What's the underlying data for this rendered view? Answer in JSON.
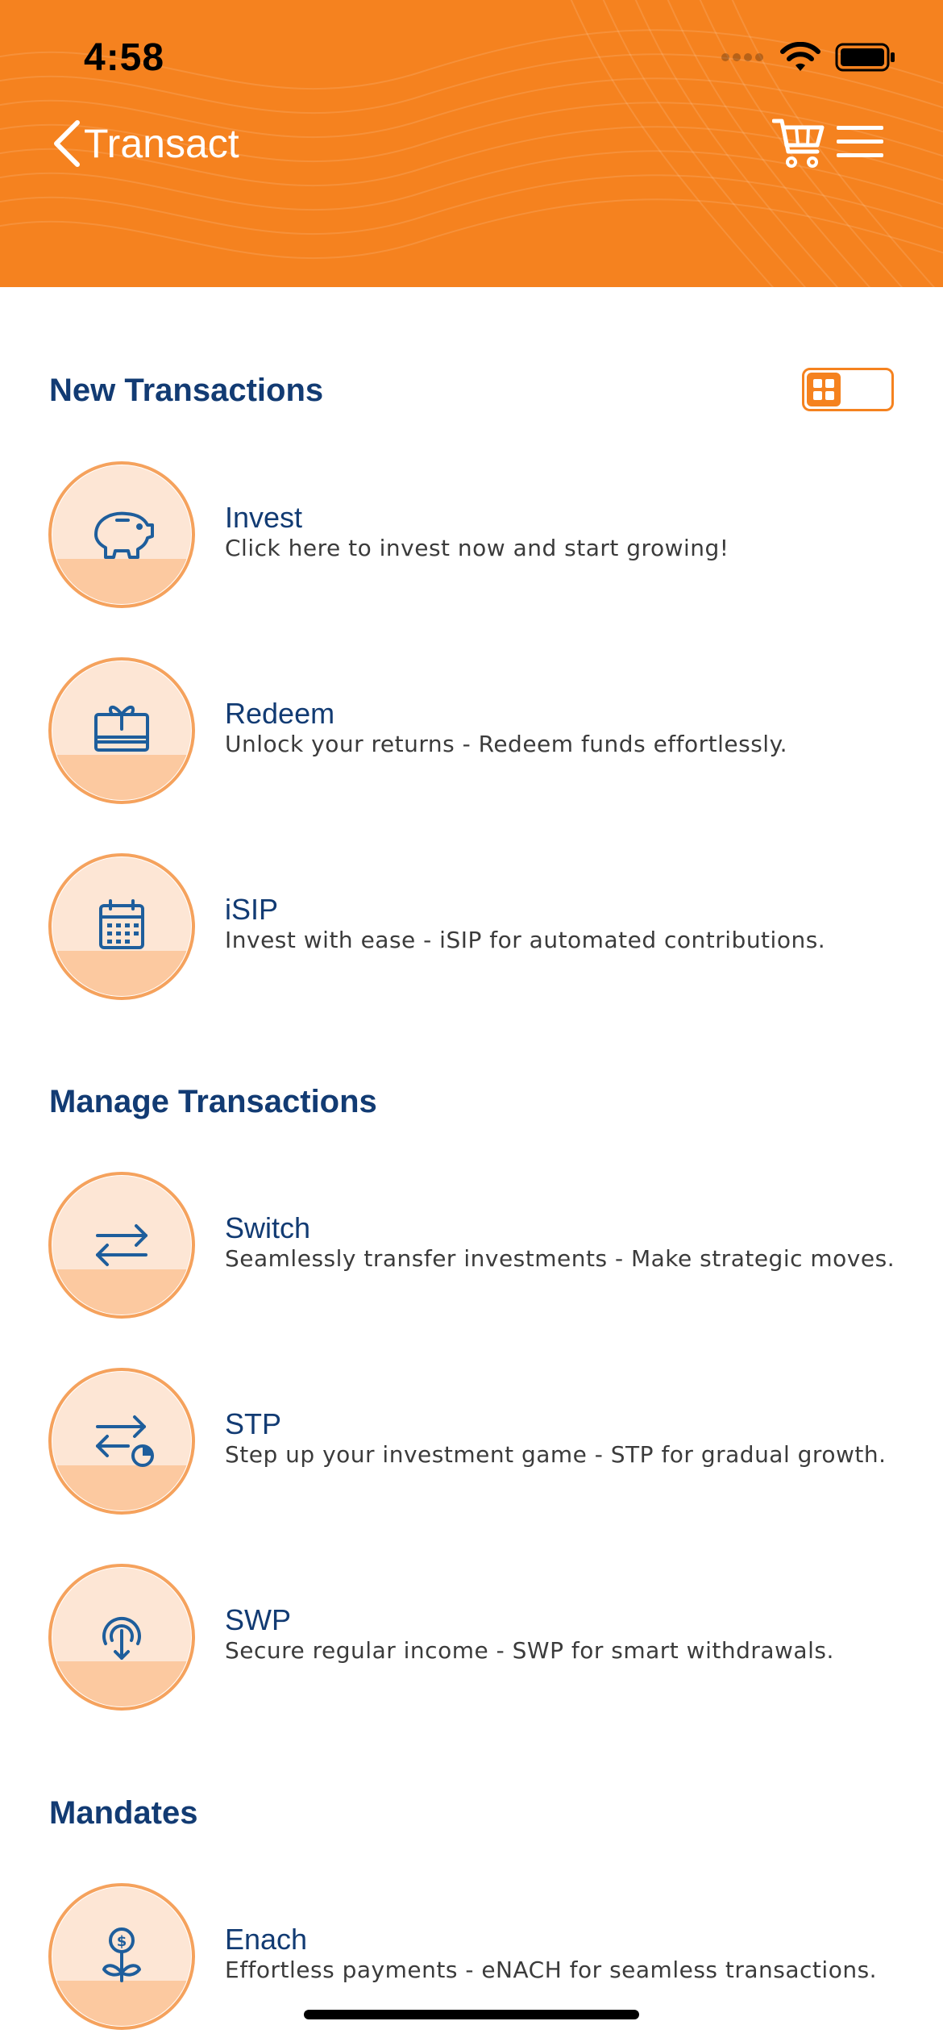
{
  "status_bar": {
    "time": "4:58"
  },
  "nav": {
    "title": "Transact",
    "back_icon": "chevron-left-icon",
    "cart_icon": "cart-icon",
    "menu_icon": "hamburger-menu-icon"
  },
  "colors": {
    "brand_orange": "#f5821f",
    "heading_blue": "#123b73",
    "circle_fill": "#fde6d5",
    "circle_bottom": "#fcc9a0",
    "icon_blue": "#1e5e9c"
  },
  "sections": {
    "new_transactions": {
      "title": "New Transactions",
      "items": [
        {
          "label": "Invest",
          "description": "Click here to invest now and start growing!",
          "icon": "piggy-bank-icon"
        },
        {
          "label": "Redeem",
          "description": "Unlock your returns - Redeem funds effortlessly.",
          "icon": "gift-card-icon"
        },
        {
          "label": "iSIP",
          "description": "Invest with ease - iSIP for automated contributions.",
          "icon": "calendar-icon"
        }
      ]
    },
    "manage_transactions": {
      "title": "Manage Transactions",
      "items": [
        {
          "label": "Switch",
          "description": "Seamlessly transfer investments - Make strategic moves.",
          "icon": "swap-arrows-icon"
        },
        {
          "label": "STP",
          "description": "Step up your investment game - STP for gradual growth.",
          "icon": "transfer-clock-icon"
        },
        {
          "label": "SWP",
          "description": "Secure regular income - SWP for smart withdrawals.",
          "icon": "withdraw-icon"
        }
      ]
    },
    "mandates": {
      "title": "Mandates",
      "items": [
        {
          "label": "Enach",
          "description": "Effortless payments - eNACH for seamless transactions.",
          "icon": "money-plant-icon"
        }
      ]
    }
  },
  "view_toggle": {
    "icon": "grid-view-icon"
  }
}
